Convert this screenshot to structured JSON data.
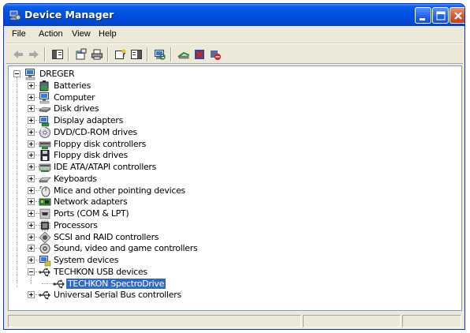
{
  "window": {
    "title": "Device Manager",
    "title_icon": "device-manager-icon",
    "controls": [
      "minimize",
      "maximize",
      "close"
    ]
  },
  "menu": {
    "items": [
      {
        "label": "File"
      },
      {
        "label": "Action"
      },
      {
        "label": "View"
      },
      {
        "label": "Help"
      }
    ]
  },
  "toolbar": {
    "buttons": [
      {
        "icon": "back-arrow-icon",
        "enabled": false
      },
      {
        "icon": "forward-arrow-icon",
        "enabled": false
      },
      {
        "icon": "show-hide-console-tree-icon"
      },
      {
        "icon": "properties-icon"
      },
      {
        "icon": "print-icon"
      },
      {
        "icon": "help-icon"
      },
      {
        "icon": "show-hide-action-pane-icon"
      },
      {
        "icon": "scan-hardware-changes-icon"
      },
      {
        "icon": "update-driver-icon"
      },
      {
        "icon": "uninstall-icon"
      },
      {
        "icon": "disable-device-icon"
      }
    ]
  },
  "tree": {
    "root": {
      "label": "DREGER",
      "icon": "computer-icon",
      "expanded": true
    },
    "categories": [
      {
        "label": "Batteries",
        "icon": "battery-icon",
        "expanded": false
      },
      {
        "label": "Computer",
        "icon": "computer-icon",
        "expanded": false
      },
      {
        "label": "Disk drives",
        "icon": "disk-drive-icon",
        "expanded": false
      },
      {
        "label": "Display adapters",
        "icon": "display-adapter-icon",
        "expanded": false
      },
      {
        "label": "DVD/CD-ROM drives",
        "icon": "cdrom-icon",
        "expanded": false
      },
      {
        "label": "Floppy disk controllers",
        "icon": "floppy-controller-icon",
        "expanded": false
      },
      {
        "label": "Floppy disk drives",
        "icon": "floppy-drive-icon",
        "expanded": false
      },
      {
        "label": "IDE ATA/ATAPI controllers",
        "icon": "ide-controller-icon",
        "expanded": false
      },
      {
        "label": "Keyboards",
        "icon": "keyboard-icon",
        "expanded": false
      },
      {
        "label": "Mice and other pointing devices",
        "icon": "mouse-icon",
        "expanded": false
      },
      {
        "label": "Network adapters",
        "icon": "network-adapter-icon",
        "expanded": false
      },
      {
        "label": "Ports (COM & LPT)",
        "icon": "port-icon",
        "expanded": false
      },
      {
        "label": "Processors",
        "icon": "processor-icon",
        "expanded": false
      },
      {
        "label": "SCSI and RAID controllers",
        "icon": "scsi-icon",
        "expanded": false
      },
      {
        "label": "Sound, video and game controllers",
        "icon": "sound-icon",
        "expanded": false
      },
      {
        "label": "System devices",
        "icon": "system-device-icon",
        "expanded": false
      },
      {
        "label": "TECHKON USB devices",
        "icon": "usb-icon",
        "expanded": true,
        "children": [
          {
            "label": "TECHKON SpectroDrive",
            "icon": "usb-icon",
            "selected": true
          }
        ]
      },
      {
        "label": "Universal Serial Bus controllers",
        "icon": "usb-icon",
        "expanded": false
      }
    ]
  },
  "colors": {
    "titlebar": "#0054e3",
    "selection": "#316ac5",
    "window_face": "#ece9d8"
  }
}
